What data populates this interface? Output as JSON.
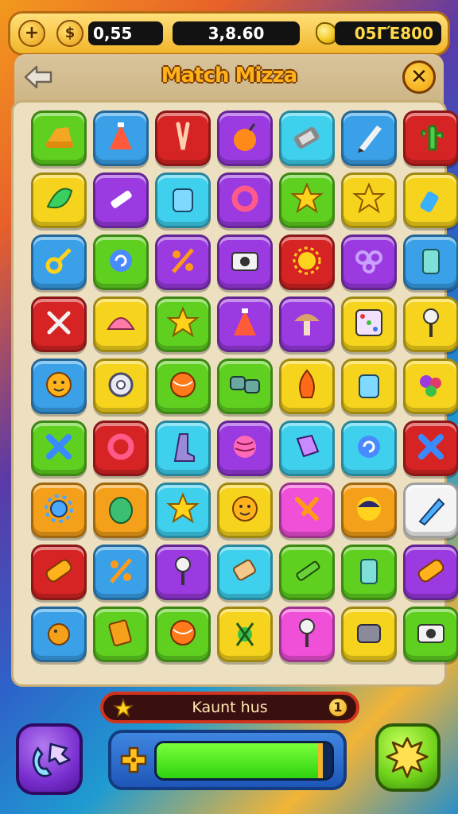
{
  "topbar": {
    "left_value": "0,55",
    "center_value": "3,8.60",
    "right_value": "05ΓΈ800"
  },
  "header": {
    "title": "Match Mizza"
  },
  "status": {
    "label": "Kaunt hus",
    "info": "1"
  },
  "progress": {
    "fill_fraction": 0.95
  },
  "colors": {
    "green": "#5fd020",
    "blue": "#3aa0e8",
    "red": "#d62424",
    "purple": "#9a3ae0",
    "cyan": "#3fd0ee",
    "yellow": "#f6d31c",
    "orange": "#f5a01a",
    "pink": "#f04fd8",
    "white": "#f4f4f4"
  },
  "board": {
    "rows": [
      [
        {
          "c": "green",
          "i": "hat-icon"
        },
        {
          "c": "blue",
          "i": "cone-icon"
        },
        {
          "c": "red",
          "i": "tweezers-icon"
        },
        {
          "c": "purple",
          "i": "bomb-icon"
        },
        {
          "c": "cyan",
          "i": "battery-icon"
        },
        {
          "c": "blue",
          "i": "pencil-icon"
        },
        {
          "c": "red",
          "i": "cactus-icon"
        }
      ],
      [
        {
          "c": "yellow",
          "i": "leaf-icon"
        },
        {
          "c": "purple",
          "i": "syringe-icon"
        },
        {
          "c": "cyan",
          "i": "jar-icon"
        },
        {
          "c": "purple",
          "i": "ring-icon"
        },
        {
          "c": "green",
          "i": "star-icon"
        },
        {
          "c": "yellow",
          "i": "star-icon"
        },
        {
          "c": "yellow",
          "i": "bottle-icon"
        }
      ],
      [
        {
          "c": "blue",
          "i": "key-icon"
        },
        {
          "c": "green",
          "i": "swirl-icon"
        },
        {
          "c": "purple",
          "i": "percent-icon"
        },
        {
          "c": "purple",
          "i": "camera-icon"
        },
        {
          "c": "red",
          "i": "sun-icon"
        },
        {
          "c": "purple",
          "i": "bubbles-icon"
        },
        {
          "c": "blue",
          "i": "cup-icon"
        }
      ],
      [
        {
          "c": "red",
          "i": "scissors-icon"
        },
        {
          "c": "yellow",
          "i": "shell-icon"
        },
        {
          "c": "green",
          "i": "star-icon"
        },
        {
          "c": "purple",
          "i": "cone-icon"
        },
        {
          "c": "purple",
          "i": "mushroom-icon"
        },
        {
          "c": "yellow",
          "i": "dice-icon"
        },
        {
          "c": "yellow",
          "i": "pin-icon"
        }
      ],
      [
        {
          "c": "blue",
          "i": "face-icon"
        },
        {
          "c": "yellow",
          "i": "donut-icon"
        },
        {
          "c": "green",
          "i": "ball-icon"
        },
        {
          "c": "green",
          "i": "link-icon"
        },
        {
          "c": "yellow",
          "i": "flame-icon"
        },
        {
          "c": "yellow",
          "i": "jar-icon"
        },
        {
          "c": "yellow",
          "i": "grapes-icon"
        }
      ],
      [
        {
          "c": "green",
          "i": "cross-icon"
        },
        {
          "c": "red",
          "i": "ring-icon"
        },
        {
          "c": "cyan",
          "i": "boot-icon"
        },
        {
          "c": "purple",
          "i": "yarn-icon"
        },
        {
          "c": "cyan",
          "i": "cube-icon"
        },
        {
          "c": "cyan",
          "i": "swirl-icon"
        },
        {
          "c": "red",
          "i": "cross-icon"
        }
      ],
      [
        {
          "c": "orange",
          "i": "gear-icon"
        },
        {
          "c": "orange",
          "i": "egg-icon"
        },
        {
          "c": "cyan",
          "i": "star-icon"
        },
        {
          "c": "yellow",
          "i": "face-icon"
        },
        {
          "c": "pink",
          "i": "ribbon-icon"
        },
        {
          "c": "orange",
          "i": "moon-icon"
        },
        {
          "c": "white",
          "i": "pen-icon"
        }
      ],
      [
        {
          "c": "red",
          "i": "bandage-icon"
        },
        {
          "c": "blue",
          "i": "percent-icon"
        },
        {
          "c": "purple",
          "i": "pin-icon"
        },
        {
          "c": "cyan",
          "i": "scroll-icon"
        },
        {
          "c": "green",
          "i": "crayon-icon"
        },
        {
          "c": "green",
          "i": "cup-icon"
        },
        {
          "c": "purple",
          "i": "bandage-icon"
        }
      ],
      [
        {
          "c": "blue",
          "i": "bird-icon"
        },
        {
          "c": "green",
          "i": "tag-icon"
        },
        {
          "c": "green",
          "i": "ball-icon"
        },
        {
          "c": "yellow",
          "i": "bug-icon"
        },
        {
          "c": "pink",
          "i": "pin-icon"
        },
        {
          "c": "yellow",
          "i": "box-icon"
        },
        {
          "c": "green",
          "i": "camera-icon"
        }
      ]
    ]
  }
}
